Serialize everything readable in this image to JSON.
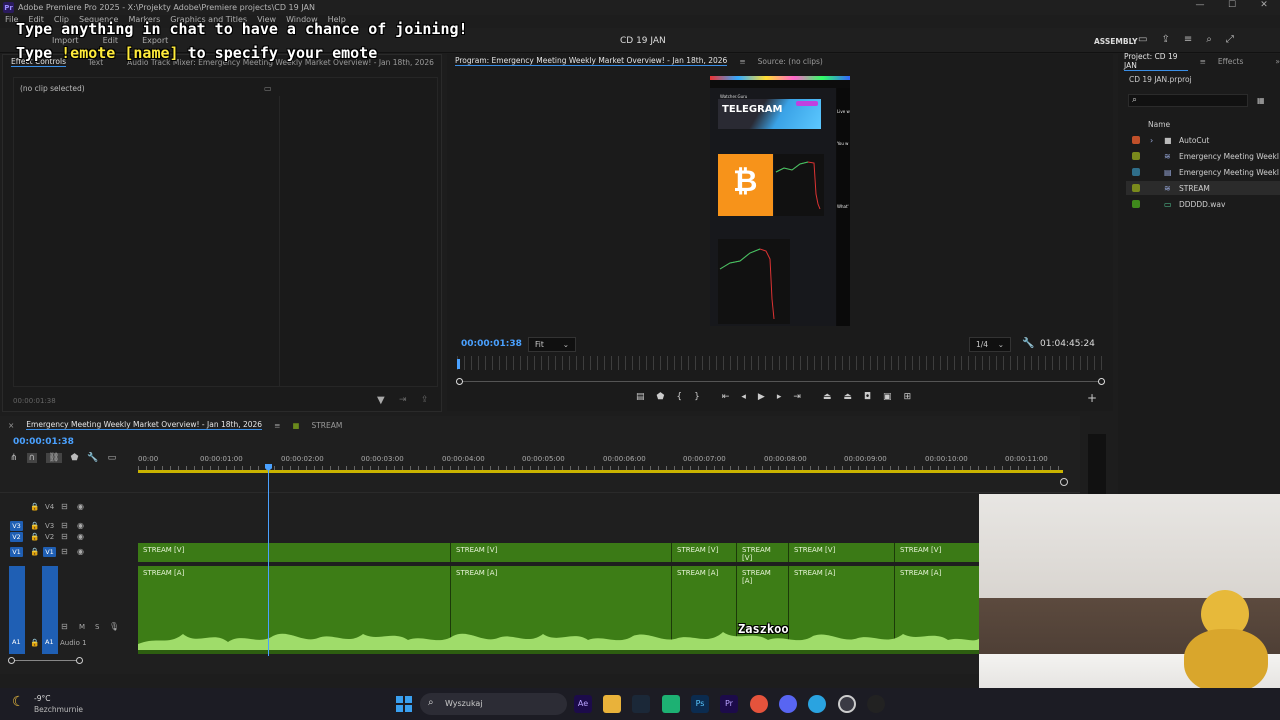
{
  "app": {
    "window_title": "Adobe Premiere Pro 2025 - X:\\Projekty Adobe\\Premiere projects\\CD 19 JAN",
    "logo_text": "Pr"
  },
  "menu": [
    "File",
    "Edit",
    "Clip",
    "Sequence",
    "Markers",
    "Graphics and Titles",
    "View",
    "Window",
    "Help"
  ],
  "header": {
    "nav": [
      "Import",
      "Edit",
      "Export"
    ],
    "sequence_name": "CD 19 JAN",
    "workspace": "ASSEMBLY"
  },
  "overlay": {
    "line1": "Type anything in chat to have a chance of joining!",
    "line2_prefix": "Type ",
    "line2_highlight": "!emote [name]",
    "line2_suffix": " to specify your emote"
  },
  "left_panel": {
    "tabs": [
      "Effect Controls",
      "Text",
      "Audio Track Mixer: Emergency Meeting Weekly Market Overview! - Jan 18th, 2026"
    ],
    "no_clip": "(no clip selected)",
    "timecode": "00:00:01:38"
  },
  "program": {
    "tab_program": "Program: Emergency Meeting Weekly Market Overview! - Jan 18th, 2026",
    "tab_source": "Source: (no clips)",
    "timecode": "00:00:01:38",
    "fit": "Fit",
    "resolution": "1/4",
    "duration": "01:04:45:24",
    "video_texts": {
      "header": "Watcher.Guru",
      "telegram": "TELEGRAM",
      "bitcoin_symbol": "₿",
      "side1": "Live w",
      "side2": "You w",
      "side3": "What'"
    }
  },
  "timeline": {
    "tabs": [
      "Emergency Meeting Weekly Market Overview! - Jan 18th, 2026",
      "STREAM"
    ],
    "timecode": "00:00:01:38",
    "ruler": [
      "00:00",
      "00:00:01:00",
      "00:00:02:00",
      "00:00:03:00",
      "00:00:04:00",
      "00:00:05:00",
      "00:00:06:00",
      "00:00:07:00",
      "00:00:08:00",
      "00:00:09:00",
      "00:00:10:00",
      "00:00:11:00"
    ],
    "tracks": {
      "v4": "V4",
      "v3": "V3",
      "v2": "V2",
      "v1": "V1",
      "a1": "A1",
      "audio_name": "Audio 1",
      "m": "M",
      "s": "S"
    },
    "video_clips": [
      "STREAM [V]",
      "STREAM [V]",
      "STREAM [V]",
      "STREAM [V]",
      "STREAM [V]",
      "STREAM [V]"
    ],
    "audio_clips": [
      "STREAM [A]",
      "STREAM [A]",
      "STREAM [A]",
      "STREAM [A]",
      "STREAM [A]",
      "STREAM [A]"
    ],
    "overlay_word": "Zaszkoo"
  },
  "project": {
    "tabs": [
      "Project: CD 19 JAN",
      "Effects"
    ],
    "file": "CD 19 JAN.prproj",
    "name_header": "Name",
    "items": [
      {
        "label": "AutoCut",
        "color": "#c0502a"
      },
      {
        "label": "Emergency Meeting Weekl",
        "color": "#7a8a1c"
      },
      {
        "label": "Emergency Meeting Weekl",
        "color": "#2f6e8a"
      },
      {
        "label": "STREAM",
        "color": "#7a8a1c"
      },
      {
        "label": "DDDDD.wav",
        "color": "#3f8a1c"
      }
    ]
  },
  "taskbar": {
    "temp": "-9°C",
    "weather": "Bezchmurnie",
    "search": "Wyszukaj"
  },
  "colors": {
    "accent": "#3a8ee6",
    "clip_green": "#3d7d16",
    "waveform": "#9fdc6a",
    "track_blue": "#1f5fb4"
  }
}
